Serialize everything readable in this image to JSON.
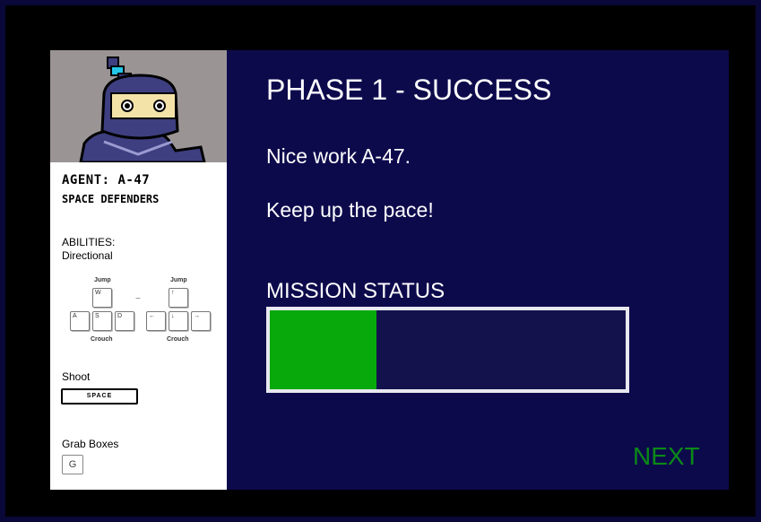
{
  "agent": {
    "name": "AGENT: A-47",
    "team": "SPACE DEFENDERS"
  },
  "abilities": {
    "heading": "ABILITIES:",
    "movement_label": "Directional",
    "movement_keys": {
      "jump_label_left": "Jump",
      "jump_label_right": "Jump",
      "crouch_label_left": "Crouch",
      "crouch_label_right": "Crouch",
      "separator": "~",
      "wasd": [
        "W",
        "A",
        "S",
        "D"
      ],
      "arrows": [
        "↑",
        "←",
        "↓",
        "→"
      ]
    },
    "shoot_label": "Shoot",
    "shoot_key": "SPACE",
    "grab_label": "Grab Boxes",
    "grab_key": "G"
  },
  "main": {
    "title": "PHASE 1 - SUCCESS",
    "message_1": "Nice work A-47.",
    "message_2": "Keep up the pace!",
    "status_label": "MISSION STATUS",
    "status_progress_fraction": 0.3,
    "next_label": "NEXT"
  },
  "colors": {
    "background": "#0d0a4c",
    "progress": "#07a90b",
    "next": "#0a8a16"
  },
  "icons": {
    "portrait": "ninja-avatar"
  }
}
